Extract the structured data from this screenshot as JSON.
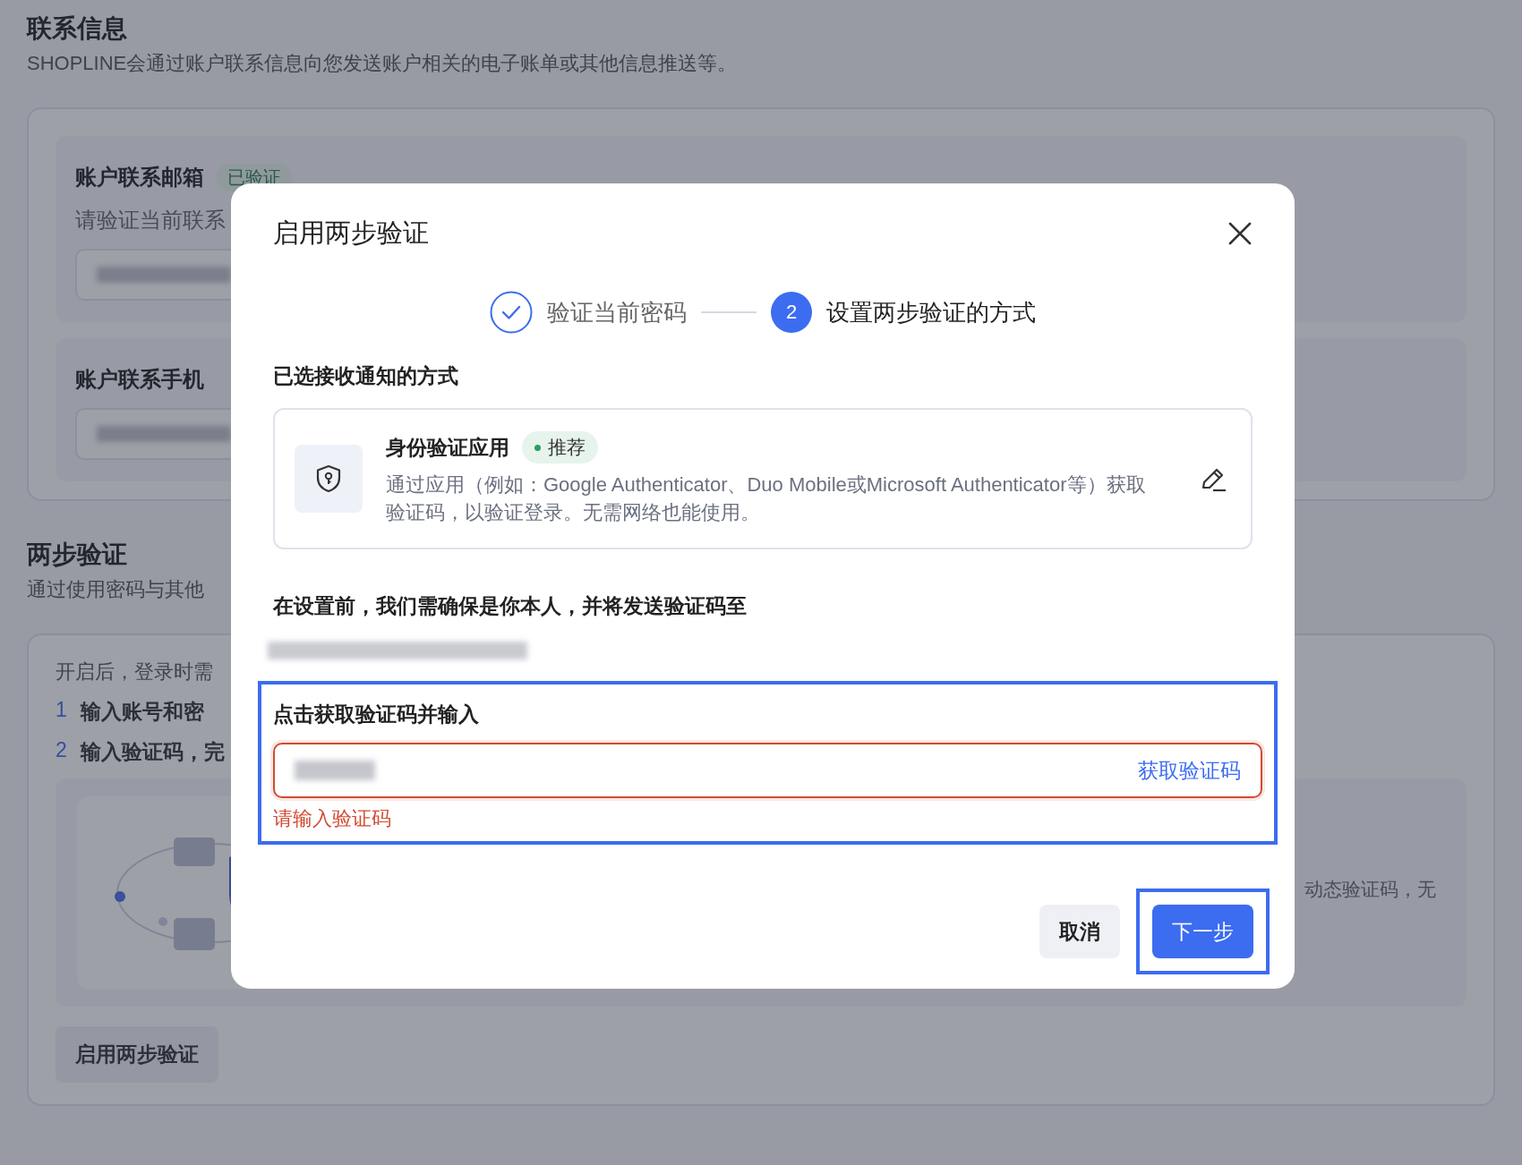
{
  "page": {
    "title": "联系信息",
    "subtitle": "SHOPLINE会通过账户联系信息向您发送账户相关的电子账单或其他信息推送等。",
    "contact_cards": [
      {
        "title": "账户联系邮箱",
        "badge": "已验证",
        "description": "请验证当前联系"
      },
      {
        "title": "账户联系手机"
      }
    ],
    "two_step": {
      "title": "两步验证",
      "subtitle": "通过使用密码与其他",
      "intro": "开启后，登录时需",
      "steps": [
        {
          "number": "1",
          "text": "输入账号和密"
        },
        {
          "number": "2",
          "text": "输入验证码，完"
        }
      ],
      "side_text": "动态验证码，无",
      "button": "启用两步验证"
    }
  },
  "dialog": {
    "title": "启用两步验证",
    "steps": [
      {
        "label": "验证当前密码",
        "done": true
      },
      {
        "label": "设置两步验证的方式",
        "done": false,
        "number": "2"
      }
    ],
    "method_label": "已选接收通知的方式",
    "method": {
      "title": "身份验证应用",
      "badge": "推荐",
      "description": "通过应用（例如：Google Authenticator、Duo Mobile或Microsoft Authenticator等）获取验证码，以验证登录。无需网络也能使用。"
    },
    "notice": "在设置前，我们需确保是你本人，并将发送验证码至",
    "code_field": {
      "label": "点击获取验证码并输入",
      "action": "获取验证码",
      "error": "请输入验证码",
      "highlighted": true
    },
    "buttons": [
      {
        "label": "取消",
        "kind": "secondary",
        "highlighted": false
      },
      {
        "label": "下一步",
        "kind": "primary",
        "highlighted": true
      }
    ]
  }
}
